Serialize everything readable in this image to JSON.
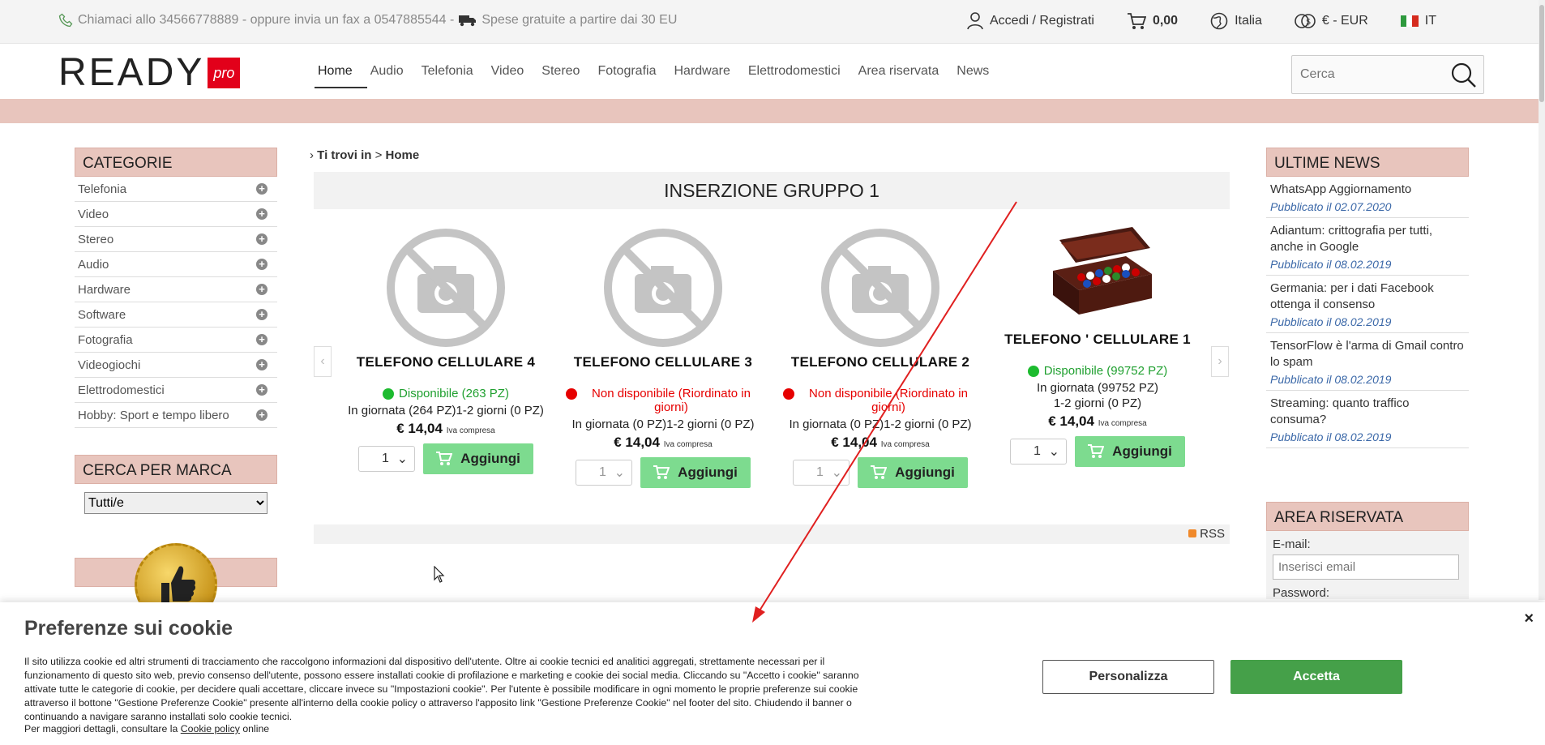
{
  "topbar": {
    "contact": "Chiamaci allo 34566778889 - oppure invia un fax a 0547885544 -",
    "shipping": "Spese gratuite a partire dai 30 EU",
    "login": "Accedi / Registrati",
    "cart_total": "0,00",
    "country": "Italia",
    "currency": "€ - EUR",
    "language": "IT"
  },
  "header": {
    "logo_text": "READY",
    "logo_suffix": "pro",
    "nav": [
      "Home",
      "Audio",
      "Telefonia",
      "Video",
      "Stereo",
      "Fotografia",
      "Hardware",
      "Elettrodomestici",
      "Area riservata",
      "News"
    ],
    "search_placeholder": "Cerca"
  },
  "sidebar": {
    "categories_title": "CATEGORIE",
    "categories": [
      "Telefonia",
      "Video",
      "Stereo",
      "Audio",
      "Hardware",
      "Software",
      "Fotografia",
      "Videogiochi",
      "Elettrodomestici",
      "Hobby: Sport e tempo libero"
    ],
    "brand_title": "CERCA PER MARCA",
    "brand_selected": "Tutti/e"
  },
  "main": {
    "breadcrumb_label": "Ti trovi in",
    "breadcrumb_sep": ">",
    "breadcrumb_current": "Home",
    "group_title": "INSERZIONE GRUPPO 1",
    "rss": "RSS",
    "products": [
      {
        "name": "TELEFONO CELLULARE 4",
        "availability": "Disponibile (263 PZ)",
        "status": "ok",
        "stock": "In giornata (264 PZ)1-2 giorni (0 PZ)",
        "price": "€ 14,04",
        "vat": "Iva compresa",
        "qty": "1",
        "add_label": "Aggiungi"
      },
      {
        "name": "TELEFONO CELLULARE 3",
        "availability": "Non disponibile (Riordinato in giorni)",
        "status": "ko",
        "stock": "In giornata (0 PZ)1-2 giorni (0 PZ)",
        "price": "€ 14,04",
        "vat": "Iva compresa",
        "qty": "1",
        "add_label": "Aggiungi"
      },
      {
        "name": "TELEFONO CELLULARE 2",
        "availability": "Non disponibile (Riordinato in giorni)",
        "status": "ko",
        "stock": "In giornata (0 PZ)1-2 giorni (0 PZ)",
        "price": "€ 14,04",
        "vat": "Iva compresa",
        "qty": "1",
        "add_label": "Aggiungi"
      },
      {
        "name": "TELEFONO ' CELLULARE 1",
        "availability": "Disponibile (99752 PZ)",
        "status": "ok",
        "stock_line1": "In giornata (99752 PZ)",
        "stock_line2": "1-2 giorni (0 PZ)",
        "price": "€ 14,04",
        "vat": "Iva compresa",
        "qty": "1",
        "add_label": "Aggiungi"
      }
    ]
  },
  "news": {
    "title": "ULTIME NEWS",
    "items": [
      {
        "title": "WhatsApp Aggiornamento",
        "date": "Pubblicato il 02.07.2020"
      },
      {
        "title": "Adiantum: crittografia per tutti, anche in Google",
        "date": "Pubblicato il 08.02.2019"
      },
      {
        "title": "Germania: per i dati Facebook ottenga il consenso",
        "date": "Pubblicato il 08.02.2019"
      },
      {
        "title": "TensorFlow è l'arma di Gmail contro lo spam",
        "date": "Pubblicato il 08.02.2019"
      },
      {
        "title": "Streaming: quanto traffico consuma?",
        "date": "Pubblicato il 08.02.2019"
      }
    ]
  },
  "area": {
    "title": "AREA RISERVATA",
    "email_label": "E-mail:",
    "email_placeholder": "Inserisci email",
    "password_label": "Password:"
  },
  "cookie": {
    "title": "Preferenze sui cookie",
    "text": "Il sito utilizza cookie ed altri strumenti di tracciamento che raccolgono informazioni dal dispositivo dell'utente. Oltre ai cookie tecnici ed analitici aggregati, strettamente necessari per il funzionamento di questo sito web, previo consenso dell'utente, possono essere installati cookie di profilazione e marketing e cookie dei social media. Cliccando su \"Accetto i cookie\" saranno attivate tutte le categorie di cookie, per decidere quali accettare, cliccare invece su \"Impostazioni cookie\". Per l'utente è possibile modificare in ogni momento le proprie preferenze sui cookie attraverso il bottone \"Gestione Preferenze Cookie\" presente all'interno della cookie policy o attraverso l'apposito link \"Gestione Preferenze Cookie\" nel footer del sito. Chiudendo il banner o continuando a navigare saranno installati solo cookie tecnici.",
    "more_prefix": "Per maggiori dettagli, consultare la",
    "more_link": "Cookie policy",
    "more_suffix": "online",
    "customize_label": "Personalizza",
    "accept_label": "Accetta",
    "close_label": "×"
  },
  "colors": {
    "accent_pink": "#e8c5bd",
    "brand_red": "#e2001a",
    "add_green": "#7ddb8f",
    "accept_green": "#45a049",
    "news_date_blue": "#3b68a8"
  }
}
